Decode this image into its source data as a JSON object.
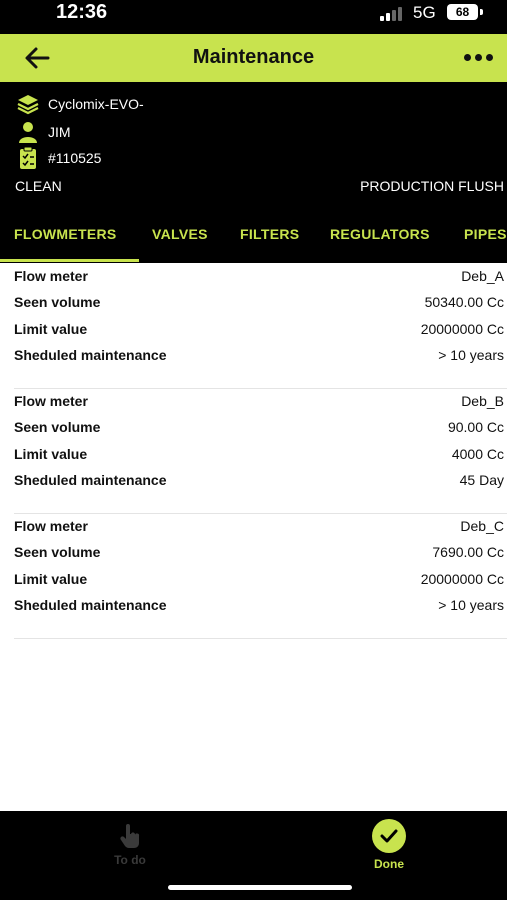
{
  "status_bar": {
    "time": "12:36",
    "network": "5G",
    "battery": "68"
  },
  "header": {
    "title": "Maintenance",
    "back_icon": "arrow-left-icon",
    "more_icon": "more-dots-icon"
  },
  "info": {
    "machine": "Cyclomix-EVO-",
    "user": "JIM",
    "order": "#110525",
    "mode_left": "CLEAN",
    "mode_right": "PRODUCTION FLUSH"
  },
  "tabs": [
    {
      "label": "FLOWMETERS",
      "active": true
    },
    {
      "label": "VALVES",
      "active": false
    },
    {
      "label": "FILTERS",
      "active": false
    },
    {
      "label": "REGULATORS",
      "active": false
    },
    {
      "label": "PIPES",
      "active": false
    }
  ],
  "labels": {
    "flow_meter": "Flow meter",
    "seen_volume": "Seen volume",
    "limit_value": "Limit value",
    "scheduled": "Sheduled maintenance"
  },
  "flowmeters": [
    {
      "name": "Deb_A",
      "seen_volume": "50340.00 Cc",
      "limit_value": "20000000  Cc",
      "scheduled": "> 10 years"
    },
    {
      "name": "Deb_B",
      "seen_volume": "90.00 Cc",
      "limit_value": "4000  Cc",
      "scheduled": "45 Day"
    },
    {
      "name": "Deb_C",
      "seen_volume": "7690.00 Cc",
      "limit_value": "20000000  Cc",
      "scheduled": "> 10 years"
    }
  ],
  "bottom_nav": {
    "todo_label": "To do",
    "done_label": "Done"
  },
  "colors": {
    "accent": "#c8e34e",
    "background_dark": "#000000",
    "text": "#111111"
  }
}
